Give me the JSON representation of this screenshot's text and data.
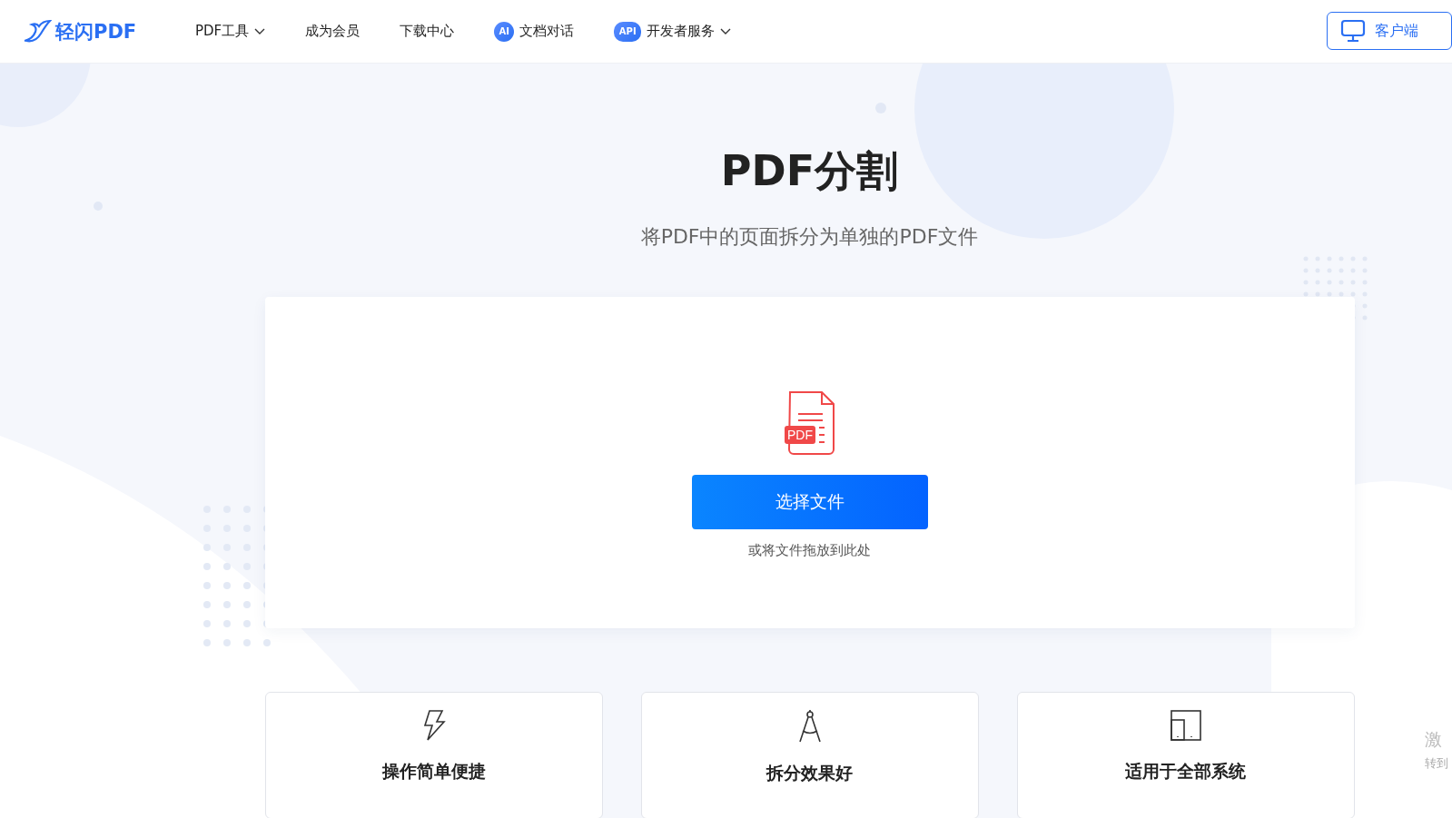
{
  "header": {
    "logo": "轻闪PDF",
    "nav": [
      {
        "label": "PDF工具",
        "kind": "dropdown"
      },
      {
        "label": "成为会员",
        "kind": "plain"
      },
      {
        "label": "下载中心",
        "kind": "plain"
      },
      {
        "label": "文档对话",
        "kind": "ai",
        "badge": "AI"
      },
      {
        "label": "开发者服务",
        "kind": "api",
        "badge": "API",
        "dropdown": true
      }
    ],
    "client_button": "客户端"
  },
  "hero": {
    "title": "PDF分割",
    "subtitle": "将PDF中的页面拆分为单独的PDF文件"
  },
  "upload": {
    "file_badge": "PDF",
    "button": "选择文件",
    "hint": "或将文件拖放到此处"
  },
  "features": [
    {
      "title": "操作简单便捷"
    },
    {
      "title": "拆分效果好"
    },
    {
      "title": "适用于全部系统"
    }
  ],
  "side_note": {
    "line1": "激",
    "line2": "转到"
  }
}
